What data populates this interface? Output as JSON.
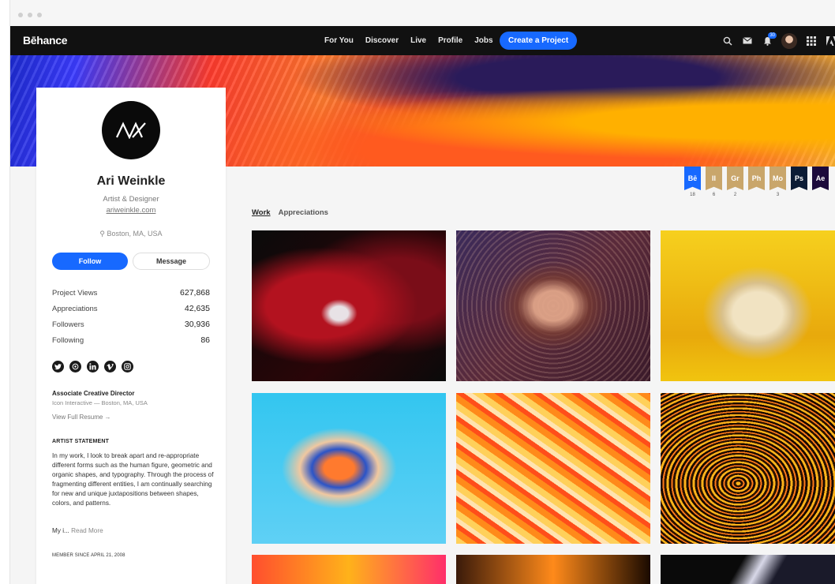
{
  "nav": {
    "logo": "Bēhance",
    "links": [
      "For You",
      "Discover",
      "Live",
      "Profile",
      "Jobs"
    ],
    "create_label": "Create a Project",
    "notification_count": "30"
  },
  "profile": {
    "name": "Ari Weinkle",
    "occupation": "Artist & Designer",
    "website": "ariweinkle.com",
    "location": "Boston, MA, USA",
    "follow_label": "Follow",
    "message_label": "Message",
    "stats": [
      {
        "label": "Project Views",
        "value": "627,868"
      },
      {
        "label": "Appreciations",
        "value": "42,635"
      },
      {
        "label": "Followers",
        "value": "30,936"
      },
      {
        "label": "Following",
        "value": "86"
      }
    ],
    "job_title": "Associate Creative Director",
    "job_company": "Icon Interactive — Boston, MA, USA",
    "resume_label": "View Full Resume →",
    "statement_heading": "ARTIST STATEMENT",
    "statement": "In my work, I look to break apart and re-appropriate different forms such as the human figure, geometric and organic shapes, and typography. Through the process of fragmenting different entities, I am continually searching for new and unique juxtapositions between shapes, colors, and patterns.",
    "statement_more_prefix": "My i...",
    "read_more": "Read More",
    "member_since": "MEMBER SINCE APRIL 21, 2008"
  },
  "tools": [
    {
      "abbr": "Bē",
      "count": "18",
      "color": "#1769ff"
    },
    {
      "abbr": "Il",
      "count": "6",
      "color": "#c9a66b"
    },
    {
      "abbr": "Gr",
      "count": "2",
      "color": "#c9a66b"
    },
    {
      "abbr": "Ph",
      "count": "",
      "color": "#c9a66b"
    },
    {
      "abbr": "Mo",
      "count": "3",
      "color": "#c9a66b"
    },
    {
      "abbr": "Ps",
      "count": "",
      "color": "#0b1b35"
    },
    {
      "abbr": "Ae",
      "count": "",
      "color": "#1c0a3c"
    }
  ],
  "tabs": {
    "work": "Work",
    "appreciations": "Appreciations"
  }
}
